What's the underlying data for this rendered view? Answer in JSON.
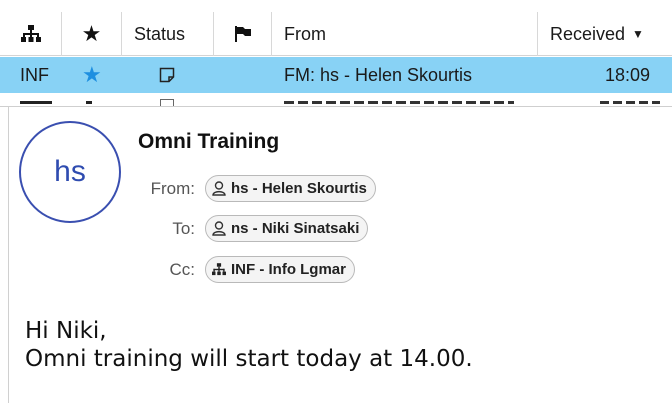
{
  "list": {
    "columns": {
      "group_icon": "hierarchy-icon",
      "flag_icon": "flag-icon",
      "star_icon": "star-icon",
      "status": "Status",
      "from": "From",
      "received": "Received"
    },
    "selected_row": {
      "account": "INF",
      "starred": true,
      "status_icon": "note-icon",
      "from": "FM: hs - Helen Skourtis",
      "received": "18:09"
    }
  },
  "message": {
    "avatar_initials": "hs",
    "subject": "Omni Training",
    "from_label": "From:",
    "from_value": "hs - Helen Skourtis",
    "to_label": "To:",
    "to_value": "ns - Niki Sinatsaki",
    "cc_label": "Cc:",
    "cc_value": "INF - Info Lgmar",
    "body_lines": [
      "Hi Niki,",
      "Omni training will start today at 14.00."
    ]
  },
  "colors": {
    "selection": "#88d2f5",
    "star": "#1e8fe0",
    "avatar": "#3a4fb0"
  }
}
